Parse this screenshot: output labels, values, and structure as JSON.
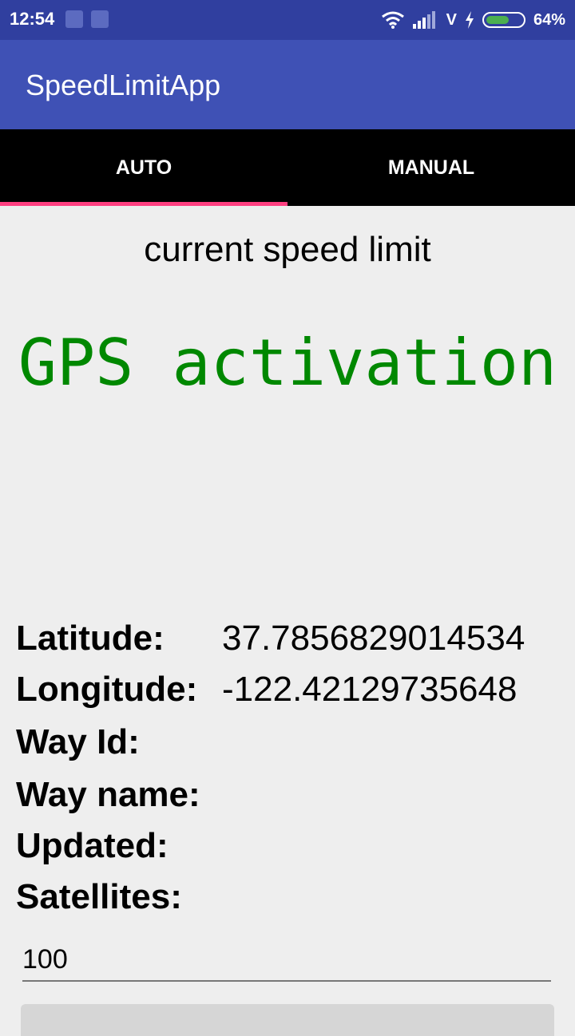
{
  "status_bar": {
    "time": "12:54",
    "carrier_letter": "V",
    "battery_percent": "64%",
    "battery_level": 0.64
  },
  "app": {
    "title": "SpeedLimitApp"
  },
  "tabs": [
    {
      "label": "AUTO",
      "selected": true
    },
    {
      "label": "MANUAL",
      "selected": false
    }
  ],
  "main": {
    "speed_limit_label": "current speed limit",
    "speed_limit_value": "GPS activation",
    "fields": [
      {
        "label": "Latitude:",
        "value": "37.7856829014534"
      },
      {
        "label": "Longitude:",
        "value": "-122.42129735648"
      },
      {
        "label": "Way Id:",
        "value": ""
      },
      {
        "label": "Way name:",
        "value": ""
      },
      {
        "label": "Updated:",
        "value": ""
      },
      {
        "label": "Satellites:",
        "value": ""
      }
    ],
    "speed_input_value": "100"
  },
  "colors": {
    "status_bar": "#303f9f",
    "app_bar": "#3f51b5",
    "tab_indicator": "#ff4081",
    "gps_text": "#008800"
  }
}
